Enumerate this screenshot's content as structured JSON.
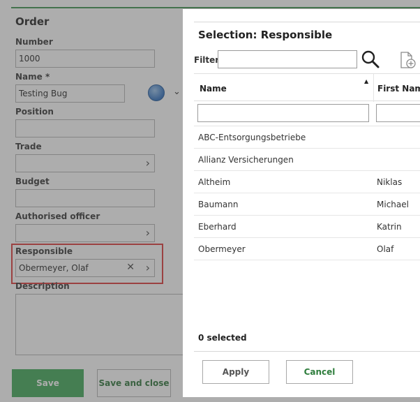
{
  "form": {
    "title": "Order",
    "fields": {
      "number": {
        "label": "Number",
        "value": "1000"
      },
      "name": {
        "label": "Name *",
        "value": "Testing Bug"
      },
      "position": {
        "label": "Position",
        "value": ""
      },
      "trade": {
        "label": "Trade",
        "value": ""
      },
      "budget": {
        "label": "Budget",
        "value": ""
      },
      "authorised_officer": {
        "label": "Authorised officer",
        "value": ""
      },
      "responsible": {
        "label": "Responsible",
        "value": "Obermeyer, Olaf"
      },
      "description": {
        "label": "Description",
        "value": ""
      }
    },
    "buttons": {
      "save": "Save",
      "save_and_close": "Save and close"
    },
    "icons": {
      "chevron": "›",
      "clear": "✕",
      "dropdown": "⌄"
    }
  },
  "dialog": {
    "title": "Selection: Responsible",
    "filter_label": "Filter",
    "filter_value": "",
    "columns": {
      "name": "Name",
      "first_name": "First Name"
    },
    "rows": [
      {
        "name": "ABC-Entsorgungsbetriebe",
        "first_name": ""
      },
      {
        "name": "Allianz Versicherungen",
        "first_name": ""
      },
      {
        "name": "Altheim",
        "first_name": "Niklas"
      },
      {
        "name": "Baumann",
        "first_name": "Michael"
      },
      {
        "name": "Eberhard",
        "first_name": "Katrin"
      },
      {
        "name": "Obermeyer",
        "first_name": "Olaf"
      }
    ],
    "selected_count": "0 selected",
    "buttons": {
      "apply": "Apply",
      "cancel": "Cancel"
    }
  },
  "colors": {
    "accent_green": "#4caf63",
    "highlight_red": "#e04545",
    "overlay": "rgba(60,60,60,0.42)"
  }
}
